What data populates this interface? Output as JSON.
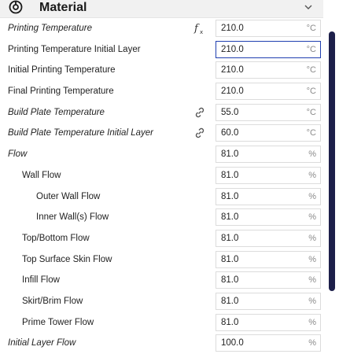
{
  "header": {
    "title": "Material",
    "icon": "material-spool-icon",
    "chevron": "chevron-down-icon"
  },
  "rows": [
    {
      "name": "printing-temperature",
      "label": "Printing Temperature",
      "italic": true,
      "indent": 0,
      "icon": "fx",
      "value": "210.0",
      "unit": "°C",
      "active": false
    },
    {
      "name": "printing-temperature-initial-layer",
      "label": "Printing Temperature Initial Layer",
      "italic": false,
      "indent": 0,
      "icon": "",
      "value": "210.0",
      "unit": "°C",
      "active": true
    },
    {
      "name": "initial-printing-temperature",
      "label": "Initial Printing Temperature",
      "italic": false,
      "indent": 0,
      "icon": "",
      "value": "210.0",
      "unit": "°C",
      "active": false
    },
    {
      "name": "final-printing-temperature",
      "label": "Final Printing Temperature",
      "italic": false,
      "indent": 0,
      "icon": "",
      "value": "210.0",
      "unit": "°C",
      "active": false
    },
    {
      "name": "build-plate-temperature",
      "label": "Build Plate Temperature",
      "italic": true,
      "indent": 0,
      "icon": "link",
      "value": "55.0",
      "unit": "°C",
      "active": false
    },
    {
      "name": "build-plate-temperature-initial-layer",
      "label": "Build Plate Temperature Initial Layer",
      "italic": true,
      "indent": 0,
      "icon": "link",
      "value": "60.0",
      "unit": "°C",
      "active": false
    },
    {
      "name": "flow",
      "label": "Flow",
      "italic": true,
      "indent": 0,
      "icon": "",
      "value": "81.0",
      "unit": "%",
      "active": false
    },
    {
      "name": "wall-flow",
      "label": "Wall Flow",
      "italic": false,
      "indent": 1,
      "icon": "",
      "value": "81.0",
      "unit": "%",
      "active": false
    },
    {
      "name": "outer-wall-flow",
      "label": "Outer Wall Flow",
      "italic": false,
      "indent": 2,
      "icon": "",
      "value": "81.0",
      "unit": "%",
      "active": false
    },
    {
      "name": "inner-walls-flow",
      "label": "Inner Wall(s) Flow",
      "italic": false,
      "indent": 2,
      "icon": "",
      "value": "81.0",
      "unit": "%",
      "active": false
    },
    {
      "name": "top-bottom-flow",
      "label": "Top/Bottom Flow",
      "italic": false,
      "indent": 1,
      "icon": "",
      "value": "81.0",
      "unit": "%",
      "active": false
    },
    {
      "name": "top-surface-skin-flow",
      "label": "Top Surface Skin Flow",
      "italic": false,
      "indent": 1,
      "icon": "",
      "value": "81.0",
      "unit": "%",
      "active": false
    },
    {
      "name": "infill-flow",
      "label": "Infill Flow",
      "italic": false,
      "indent": 1,
      "icon": "",
      "value": "81.0",
      "unit": "%",
      "active": false
    },
    {
      "name": "skirt-brim-flow",
      "label": "Skirt/Brim Flow",
      "italic": false,
      "indent": 1,
      "icon": "",
      "value": "81.0",
      "unit": "%",
      "active": false
    },
    {
      "name": "prime-tower-flow",
      "label": "Prime Tower Flow",
      "italic": false,
      "indent": 1,
      "icon": "",
      "value": "81.0",
      "unit": "%",
      "active": false
    },
    {
      "name": "initial-layer-flow",
      "label": "Initial Layer Flow",
      "italic": true,
      "indent": 0,
      "icon": "",
      "value": "100.0",
      "unit": "%",
      "active": false
    }
  ],
  "colors": {
    "active_border": "#1f3fb0",
    "scrollbar": "#1d1f4a",
    "header_bg": "#f1f1f1"
  }
}
